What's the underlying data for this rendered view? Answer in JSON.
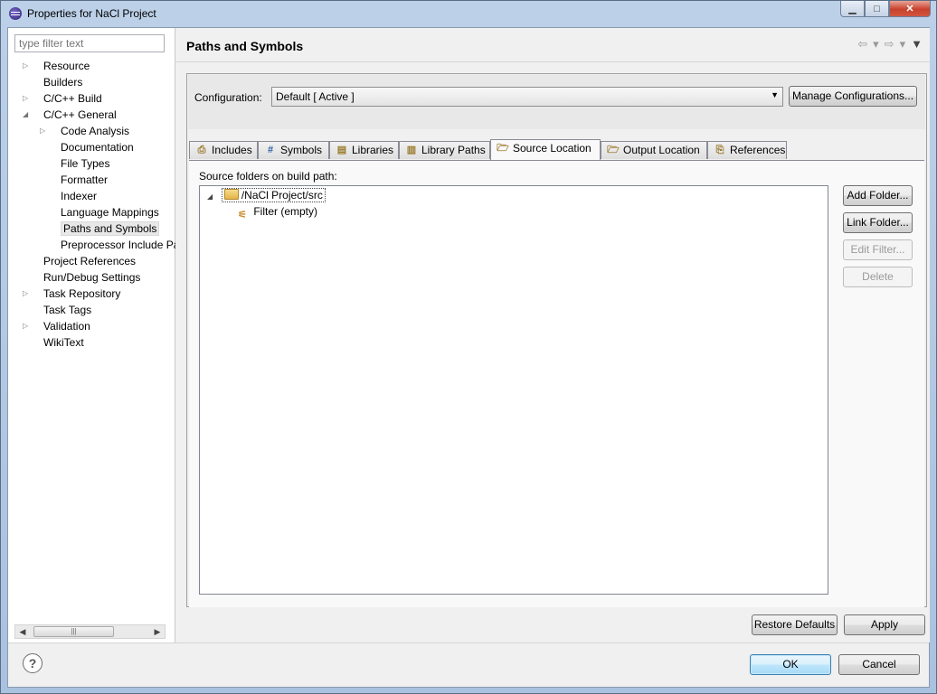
{
  "window": {
    "title": "Properties for NaCl Project",
    "buttons": {
      "minimize": "▁",
      "maximize": "□",
      "close": "✕"
    }
  },
  "filter": {
    "placeholder": "type filter text"
  },
  "nav_tree": [
    {
      "label": "Resource",
      "level": 0,
      "twisty": "collapsed"
    },
    {
      "label": "Builders",
      "level": 0,
      "twisty": "none"
    },
    {
      "label": "C/C++ Build",
      "level": 0,
      "twisty": "collapsed"
    },
    {
      "label": "C/C++ General",
      "level": 0,
      "twisty": "expanded"
    },
    {
      "label": "Code Analysis",
      "level": 1,
      "twisty": "collapsed"
    },
    {
      "label": "Documentation",
      "level": 1,
      "twisty": "none"
    },
    {
      "label": "File Types",
      "level": 1,
      "twisty": "none"
    },
    {
      "label": "Formatter",
      "level": 1,
      "twisty": "none"
    },
    {
      "label": "Indexer",
      "level": 1,
      "twisty": "none"
    },
    {
      "label": "Language Mappings",
      "level": 1,
      "twisty": "none"
    },
    {
      "label": "Paths and Symbols",
      "level": 1,
      "twisty": "none",
      "selected": true
    },
    {
      "label": "Preprocessor Include Pa",
      "level": 1,
      "twisty": "none"
    },
    {
      "label": "Project References",
      "level": 0,
      "twisty": "none"
    },
    {
      "label": "Run/Debug Settings",
      "level": 0,
      "twisty": "none"
    },
    {
      "label": "Task Repository",
      "level": 0,
      "twisty": "collapsed"
    },
    {
      "label": "Task Tags",
      "level": 0,
      "twisty": "none"
    },
    {
      "label": "Validation",
      "level": 0,
      "twisty": "collapsed"
    },
    {
      "label": "WikiText",
      "level": 0,
      "twisty": "none"
    }
  ],
  "page": {
    "title": "Paths and Symbols",
    "nav": {
      "back": "⇦",
      "forward": "⇨",
      "dropdown": "▾",
      "menu": "▼"
    }
  },
  "configuration": {
    "label": "Configuration:",
    "value": "Default  [ Active ]",
    "manage_button": "Manage Configurations..."
  },
  "tabs": [
    {
      "label": "Includes",
      "icon": "includes-icon",
      "glyph": "⎙",
      "active": false
    },
    {
      "label": "Symbols",
      "icon": "hash-icon",
      "glyph": "#",
      "active": false
    },
    {
      "label": "Libraries",
      "icon": "libraries-icon",
      "glyph": "▤",
      "active": false
    },
    {
      "label": "Library Paths",
      "icon": "library-paths-icon",
      "glyph": "▥",
      "active": false
    },
    {
      "label": "Source Location",
      "icon": "folder-icon",
      "glyph": "🗁",
      "active": true
    },
    {
      "label": "Output Location",
      "icon": "output-folder-icon",
      "glyph": "🗁",
      "active": false
    },
    {
      "label": "References",
      "icon": "references-icon",
      "glyph": "⎘",
      "active": false
    }
  ],
  "source_location": {
    "label": "Source folders on build path:",
    "tree": [
      {
        "label": "/NaCl Project/src",
        "expanded": true,
        "twisty": "◢"
      },
      {
        "label": "Filter (empty)"
      }
    ],
    "buttons": {
      "add_folder": "Add Folder...",
      "link_folder": "Link Folder...",
      "edit_filter": "Edit Filter...",
      "delete": "Delete"
    }
  },
  "page_buttons": {
    "restore_defaults": "Restore Defaults",
    "apply": "Apply"
  },
  "dialog_buttons": {
    "help": "?",
    "ok": "OK",
    "cancel": "Cancel"
  },
  "scrollbar": {
    "left_arrow": "◀",
    "right_arrow": "▶",
    "grip": "|||"
  }
}
